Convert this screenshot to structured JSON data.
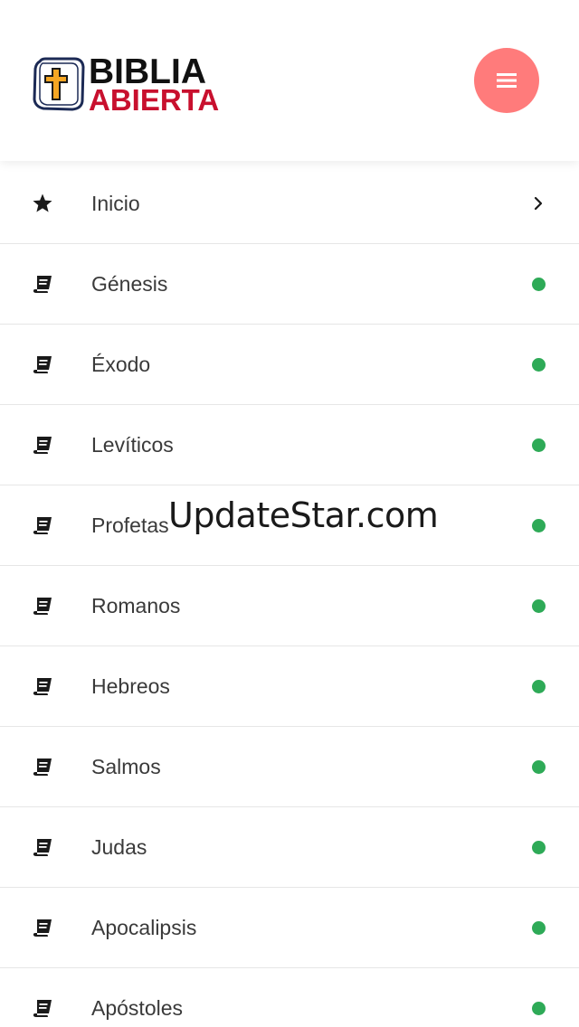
{
  "header": {
    "logo_line1": "BIBLIA",
    "logo_line2": "ABIERTA",
    "menu_icon": "hamburger-menu-icon",
    "menu_button_color": "#ff7b7b"
  },
  "nav": {
    "items": [
      {
        "label": "Inicio",
        "icon": "star-icon",
        "end": "chevron-right-icon"
      },
      {
        "label": "Génesis",
        "icon": "book-icon",
        "end": "status-dot"
      },
      {
        "label": "Éxodo",
        "icon": "book-icon",
        "end": "status-dot"
      },
      {
        "label": "Levíticos",
        "icon": "book-icon",
        "end": "status-dot"
      },
      {
        "label": "Profetas",
        "icon": "book-icon",
        "end": "status-dot"
      },
      {
        "label": "Romanos",
        "icon": "book-icon",
        "end": "status-dot"
      },
      {
        "label": "Hebreos",
        "icon": "book-icon",
        "end": "status-dot"
      },
      {
        "label": "Salmos",
        "icon": "book-icon",
        "end": "status-dot"
      },
      {
        "label": "Judas",
        "icon": "book-icon",
        "end": "status-dot"
      },
      {
        "label": "Apocalipsis",
        "icon": "book-icon",
        "end": "status-dot"
      },
      {
        "label": "Apóstoles",
        "icon": "book-icon",
        "end": "status-dot"
      }
    ],
    "status_dot_color": "#2eaa57"
  },
  "watermark": "UpdateStar.com"
}
